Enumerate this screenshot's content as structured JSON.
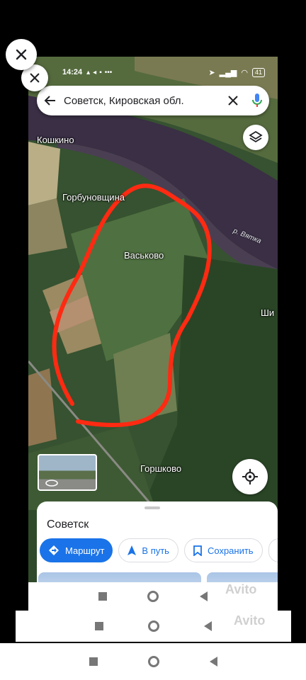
{
  "status": {
    "time": "14:24",
    "battery": "41"
  },
  "search": {
    "query": "Советск, Кировская обл."
  },
  "map_labels": {
    "koshkino": "Кошкино",
    "gorbunovshina": "Горбуновщина",
    "vaskovo": "Васьково",
    "gorshkovo": "Горшково",
    "shi": "Ши",
    "river": "р. Вятка"
  },
  "sheet": {
    "title": "Советск",
    "route_label": "Маршрут",
    "start_label": "В путь",
    "save_label": "Сохранить"
  },
  "watermark": {
    "text": "Avito"
  },
  "icons": [
    "close-icon",
    "back-arrow-icon",
    "clear-icon",
    "mic-icon",
    "layers-icon",
    "locate-icon",
    "route-icon",
    "navigation-icon",
    "bookmark-icon"
  ],
  "colors": {
    "accent": "#1a73e8",
    "outline": "#ff2a12",
    "river": "#3a2f45"
  }
}
